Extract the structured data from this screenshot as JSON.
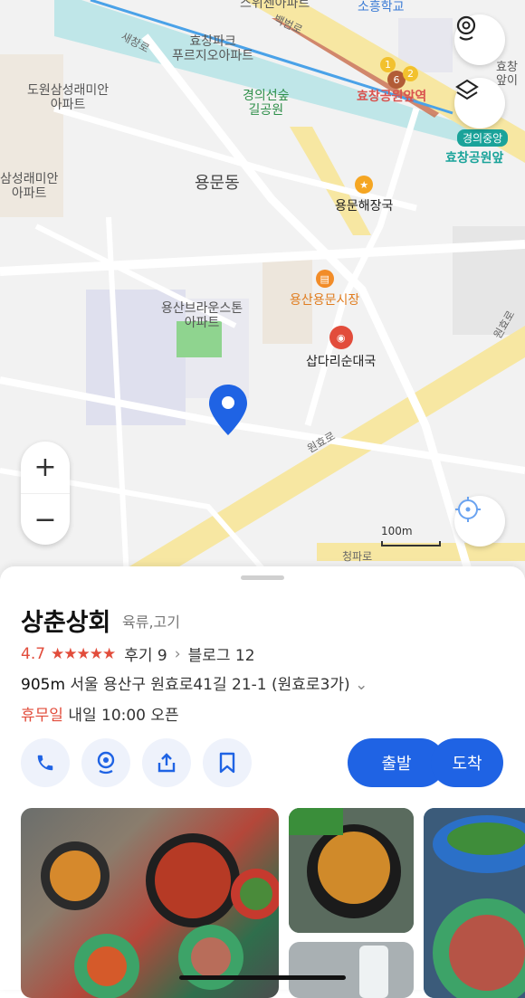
{
  "map": {
    "labels": {
      "dong": "용문동",
      "hyochang_park": "효창파크\n푸르지오아파트",
      "dowon_apt": "도원삼성래미안\n아파트",
      "samsung_apt": "삼성래미안\n아파트",
      "yongsan_brown": "용산브라운스톤\n아파트",
      "park": "경의선숲\n길공원",
      "school": "소흥학교",
      "swiss": "스위센아파트",
      "hyochang_right": "효창\n앞이"
    },
    "roads": {
      "saechang": "새창로",
      "baekbeom": "백범로",
      "wonhyo1": "원효로",
      "wonhyo2": "원효로",
      "cheongpa": "청파로",
      "side": "청파로"
    },
    "pois": {
      "haejangguk": "용문해장국",
      "market": "용산용문시장",
      "sundae": "삽다리순대국",
      "station": "효창공원앞역",
      "station2": "효창공원앞",
      "gyeongui": "경의중앙"
    },
    "station_nums": [
      "1",
      "6",
      "2"
    ],
    "scale": "100m",
    "colors": {
      "accent": "#1f63e4",
      "star": "#f5a623",
      "market": "#f28c28",
      "red": "#e24c3b"
    }
  },
  "sheet": {
    "name": "상춘상회",
    "category": "육류,고기",
    "rating": "4.7",
    "stars": "★★★★★",
    "reviews": "후기 9",
    "chevron": "›",
    "blog": "블로그 12",
    "distance": "905m",
    "address": "서울 용산구 원효로41길 21-1 (원효로3가)",
    "address_chev": "⌄",
    "closed": "휴무일",
    "next_open": "내일 10:00 오픈",
    "depart": "출발",
    "arrive": "도착"
  }
}
